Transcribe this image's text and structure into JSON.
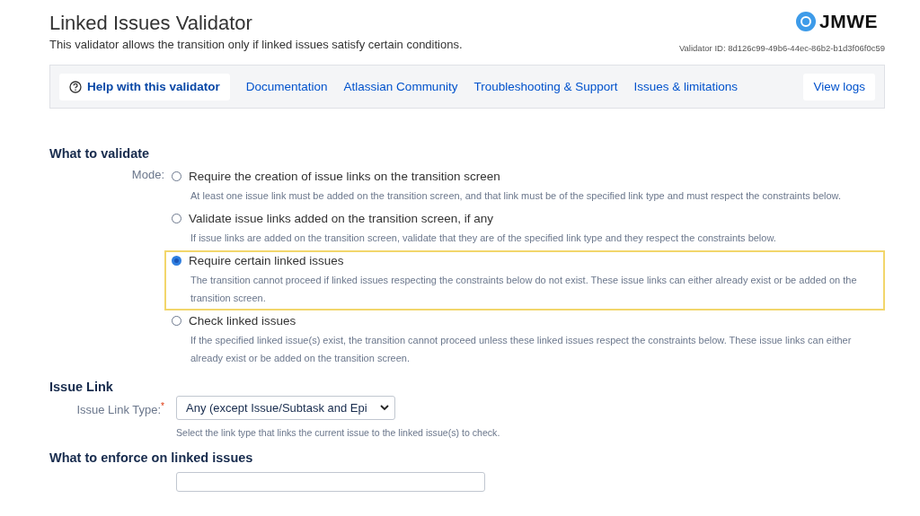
{
  "header": {
    "title": "Linked Issues Validator",
    "subtitle": "This validator allows the transition only if linked issues satisfy certain conditions.",
    "logo_text": "JMWE",
    "validator_id": "Validator ID: 8d126c99-49b6-44ec-86b2-b1d3f06f0c59"
  },
  "toolbar": {
    "help": "Help with this validator",
    "links": [
      "Documentation",
      "Atlassian Community",
      "Troubleshooting & Support",
      "Issues & limitations"
    ],
    "view_logs": "View logs"
  },
  "validate_section": {
    "heading": "What to validate",
    "mode_label": "Mode:",
    "options": [
      {
        "label": "Require the creation of issue links on the transition screen",
        "description": "At least one issue link must be added on the transition screen, and that link must be of the specified link type and must respect the constraints below.",
        "selected": false,
        "highlighted": false
      },
      {
        "label": "Validate issue links added on the transition screen, if any",
        "description": "If issue links are added on the transition screen, validate that they are of the specified link type and they respect the constraints below.",
        "selected": false,
        "highlighted": false
      },
      {
        "label": "Require certain linked issues",
        "description": "The transition cannot proceed if linked issues respecting the constraints below do not exist. These issue links can either already exist or be added on the transition screen.",
        "selected": true,
        "highlighted": true
      },
      {
        "label": "Check linked issues",
        "description": "If the specified linked issue(s) exist, the transition cannot proceed unless these linked issues respect the constraints below. These issue links can either already exist or be added on the transition screen.",
        "selected": false,
        "highlighted": false
      }
    ]
  },
  "issue_link_section": {
    "heading": "Issue Link",
    "field_label": "Issue Link Type:",
    "required_mark": "*",
    "value": "Any (except Issue/Subtask and Epi",
    "help": "Select the link type that links the current issue to the linked issue(s) to check."
  },
  "enforce_section": {
    "heading": "What to enforce on linked issues"
  }
}
